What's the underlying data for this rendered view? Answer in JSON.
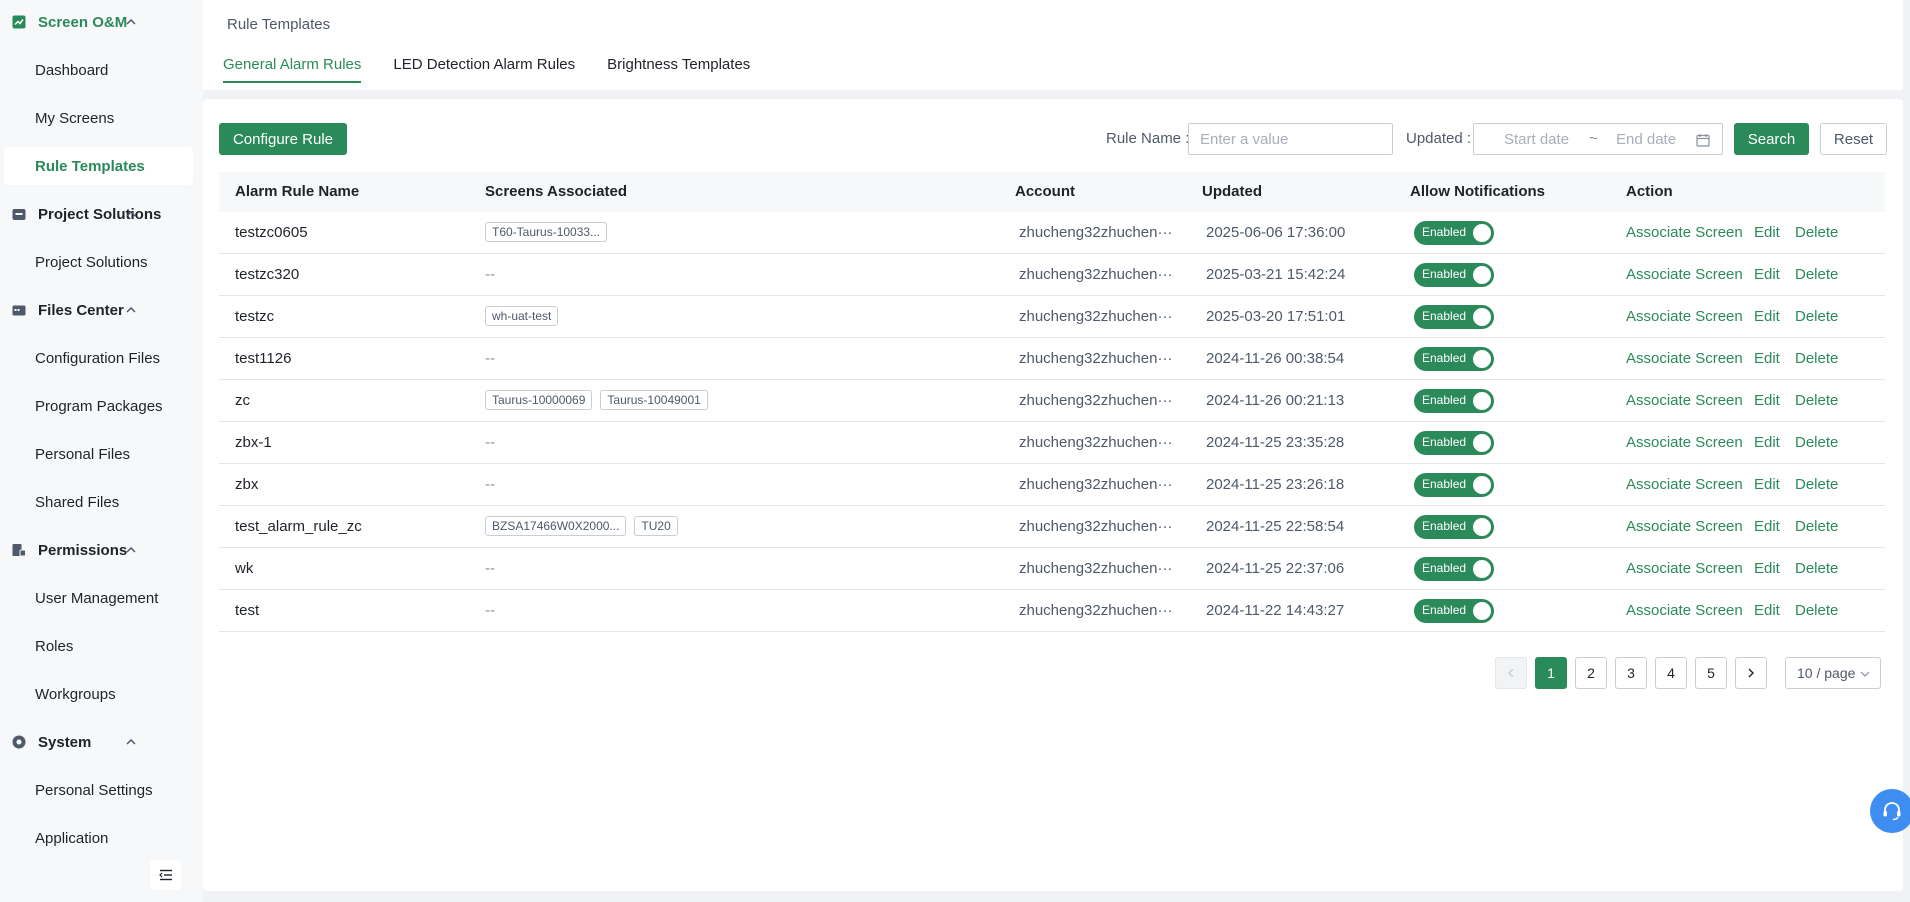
{
  "sidebar": {
    "groups": [
      {
        "title": "Screen O&M",
        "icon": "chart-line-icon",
        "items": [
          "Dashboard",
          "My Screens",
          "Rule Templates"
        ]
      },
      {
        "title": "Project Solutions",
        "icon": "briefcase-icon",
        "items": [
          "Project Solutions"
        ]
      },
      {
        "title": "Files Center",
        "icon": "folder-icon",
        "items": [
          "Configuration Files",
          "Program Packages",
          "Personal Files",
          "Shared Files"
        ]
      },
      {
        "title": "Permissions",
        "icon": "user-lock-icon",
        "items": [
          "User Management",
          "Roles",
          "Workgroups"
        ]
      },
      {
        "title": "System",
        "icon": "gear-icon",
        "items": [
          "Personal Settings",
          "Application"
        ]
      }
    ],
    "active_item": "Rule Templates",
    "collapse_icon": "menu-fold-icon"
  },
  "header": {
    "breadcrumb": "Rule Templates",
    "tabs": [
      "General Alarm Rules",
      "LED Detection Alarm Rules",
      "Brightness Templates"
    ],
    "active_tab": "General Alarm Rules"
  },
  "toolbar": {
    "configure_label": "Configure Rule",
    "rule_name_label": "Rule Name :",
    "rule_name_placeholder": "Enter a value",
    "updated_label": "Updated :",
    "start_placeholder": "Start date",
    "range_sep": "~",
    "end_placeholder": "End date",
    "search_label": "Search",
    "reset_label": "Reset"
  },
  "table": {
    "columns": [
      "Alarm Rule Name",
      "Screens Associated",
      "Account",
      "Updated",
      "Allow Notifications",
      "Action"
    ],
    "rows": [
      {
        "name": "testzc0605",
        "screens": [
          "T60-Taurus-10033..."
        ],
        "account": "zhucheng32zhuchen···",
        "updated": "2025-06-06 17:36:00",
        "status": "Enabled"
      },
      {
        "name": "testzc320",
        "screens": [],
        "account": "zhucheng32zhuchen···",
        "updated": "2025-03-21 15:42:24",
        "status": "Enabled"
      },
      {
        "name": "testzc",
        "screens": [
          "wh-uat-test"
        ],
        "account": "zhucheng32zhuchen···",
        "updated": "2025-03-20 17:51:01",
        "status": "Enabled"
      },
      {
        "name": "test1126",
        "screens": [],
        "account": "zhucheng32zhuchen···",
        "updated": "2024-11-26 00:38:54",
        "status": "Enabled"
      },
      {
        "name": "zc",
        "screens": [
          "Taurus-10000069",
          "Taurus-10049001"
        ],
        "account": "zhucheng32zhuchen···",
        "updated": "2024-11-26 00:21:13",
        "status": "Enabled"
      },
      {
        "name": "zbx-1",
        "screens": [],
        "account": "zhucheng32zhuchen···",
        "updated": "2024-11-25 23:35:28",
        "status": "Enabled"
      },
      {
        "name": "zbx",
        "screens": [],
        "account": "zhucheng32zhuchen···",
        "updated": "2024-11-25 23:26:18",
        "status": "Enabled"
      },
      {
        "name": "test_alarm_rule_zc",
        "screens": [
          "BZSA17466W0X2000...",
          "TU20"
        ],
        "account": "zhucheng32zhuchen···",
        "updated": "2024-11-25 22:58:54",
        "status": "Enabled"
      },
      {
        "name": "wk",
        "screens": [],
        "account": "zhucheng32zhuchen···",
        "updated": "2024-11-25 22:37:06",
        "status": "Enabled"
      },
      {
        "name": "test",
        "screens": [],
        "account": "zhucheng32zhuchen···",
        "updated": "2024-11-22 14:43:27",
        "status": "Enabled"
      }
    ],
    "empty_text": "--",
    "actions": [
      "Associate Screen",
      "Edit",
      "Delete"
    ]
  },
  "pagination": {
    "pages": [
      "1",
      "2",
      "3",
      "4",
      "5"
    ],
    "current": "1",
    "page_size": "10 / page"
  },
  "colors": {
    "accent": "#2b8a5a",
    "fab": "#3d8ef0"
  }
}
